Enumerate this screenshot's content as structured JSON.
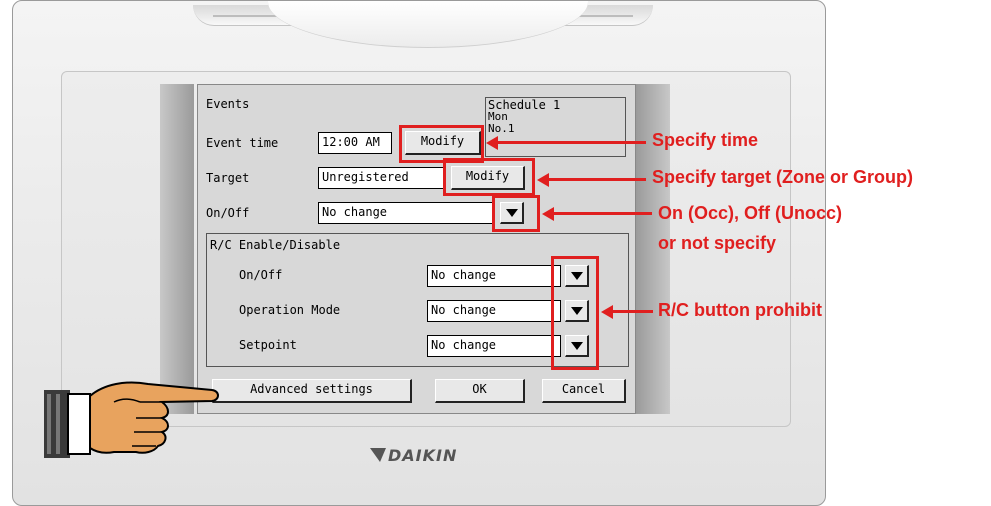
{
  "screen": {
    "title": "Events",
    "schedule": {
      "line1": "Schedule 1",
      "line2": "Mon",
      "line3": "No.1"
    },
    "event_time": {
      "label": "Event time",
      "value": "12:00 AM",
      "modify_label": "Modify"
    },
    "target": {
      "label": "Target",
      "value": "Unregistered",
      "modify_label": "Modify"
    },
    "onoff": {
      "label": "On/Off",
      "value": "No change"
    },
    "rc": {
      "title": "R/C Enable/Disable",
      "rows": [
        {
          "label": "On/Off",
          "value": "No change"
        },
        {
          "label": "Operation Mode",
          "value": "No change"
        },
        {
          "label": "Setpoint",
          "value": "No change"
        }
      ]
    },
    "buttons": {
      "advanced": "Advanced settings",
      "ok": "OK",
      "cancel": "Cancel"
    }
  },
  "device": {
    "brand": "DAIKIN"
  },
  "annotations": {
    "time": "Specify time",
    "target": "Specify target (Zone or Group)",
    "onoff_line1": "On (Occ), Off (Unocc)",
    "onoff_line2": "or not specify",
    "rc": "R/C button prohibit",
    "color": "#e01f1f"
  }
}
